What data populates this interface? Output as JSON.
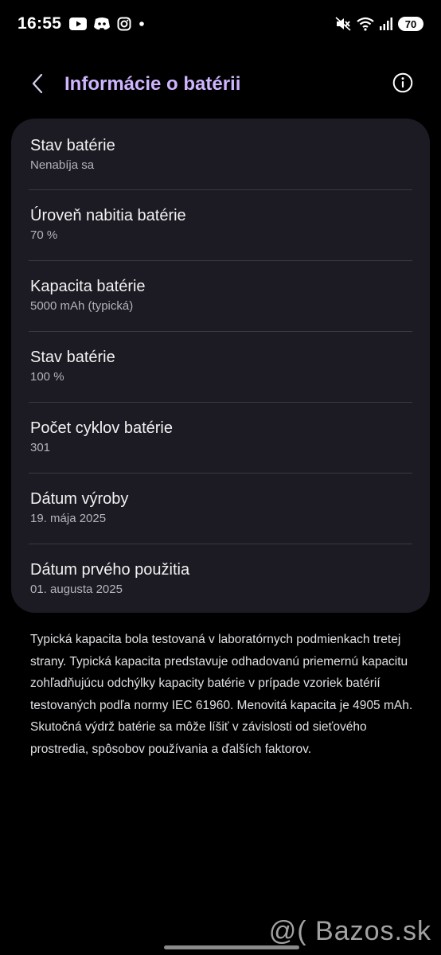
{
  "status_bar": {
    "time": "16:55",
    "left_icons": [
      "youtube-icon",
      "discord-icon",
      "instagram-icon",
      "dot-icon"
    ],
    "right_icons": [
      "mute-icon",
      "wifi-icon",
      "signal-icon"
    ],
    "battery_level": "70"
  },
  "header": {
    "title": "Informácie o batérii",
    "back_icon": "chevron-left-icon",
    "info_icon": "info-icon"
  },
  "battery_items": [
    {
      "title": "Stav batérie",
      "value": "Nenabíja sa"
    },
    {
      "title": "Úroveň nabitia batérie",
      "value": "70 %"
    },
    {
      "title": "Kapacita batérie",
      "value": "5000 mAh (typická)"
    },
    {
      "title": "Stav batérie",
      "value": "100 %"
    },
    {
      "title": "Počet cyklov batérie",
      "value": "301"
    },
    {
      "title": "Dátum výroby",
      "value": "19. mája 2025"
    },
    {
      "title": "Dátum prvého použitia",
      "value": "01. augusta 2025"
    }
  ],
  "footnote": "Typická kapacita bola testovaná v laboratórnych podmienkach tretej strany. Typická kapacita predstavuje odhadovanú priemernú kapacitu zohľadňujúcu odchýlky kapacity batérie v prípade vzoriek batérií testovaných podľa normy IEC 61960. Menovitá kapacita je 4905 mAh. Skutočná výdrž batérie sa môže líšiť v závislosti od sieťového prostredia, spôsobov používania a ďalších faktorov.",
  "watermark": "@( Bazos.sk",
  "colors": {
    "background": "#000000",
    "card": "#1c1a22",
    "title_accent": "#cfb4ff",
    "divider": "#3a3842"
  }
}
